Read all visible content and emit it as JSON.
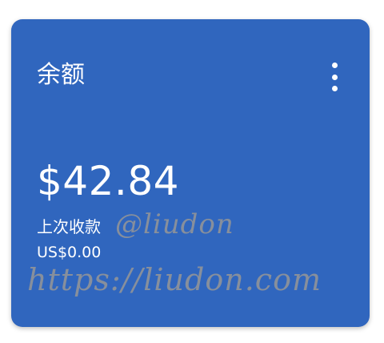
{
  "card": {
    "title": "余额",
    "balance": "$42.84",
    "last_payment_label": "上次收款",
    "last_payment_value": "US$0.00",
    "menu_icon": "more-vert-icon"
  },
  "watermark": {
    "handle": "@liudon",
    "url": "https://liudon.com"
  },
  "colors": {
    "card_background": "#3066be",
    "text": "#ffffff",
    "watermark": "#969696"
  }
}
